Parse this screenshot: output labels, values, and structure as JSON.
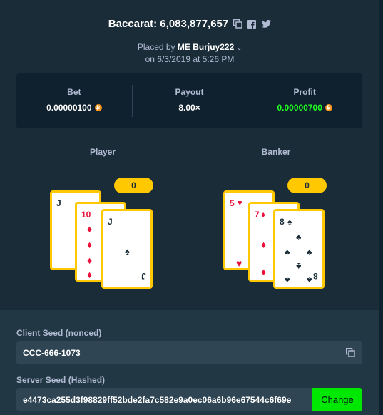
{
  "header": {
    "title": "Baccarat: 6,083,877,657",
    "placed_by_prefix": "Placed by",
    "placed_by_user": "ME Burjuy222",
    "placed_on": "on 6/3/2019 at 5:26 PM"
  },
  "stats": {
    "bet_label": "Bet",
    "bet_value": "0.00000100",
    "payout_label": "Payout",
    "payout_value": "8.00×",
    "profit_label": "Profit",
    "profit_value": "0.00000700",
    "currency_icon": "bitcoin-icon",
    "profit_color": "#1fff20"
  },
  "player": {
    "label": "Player",
    "score": "0",
    "cards": [
      {
        "rank": "J",
        "suit": "♠",
        "color": "black"
      },
      {
        "rank": "10",
        "suit": "♦",
        "color": "red"
      },
      {
        "rank": "J",
        "suit": "♠",
        "color": "black"
      }
    ]
  },
  "banker": {
    "label": "Banker",
    "score": "0",
    "cards": [
      {
        "rank": "5",
        "suit": "♥",
        "color": "red"
      },
      {
        "rank": "7",
        "suit": "♦",
        "color": "red"
      },
      {
        "rank": "8",
        "suit": "♠",
        "color": "black"
      }
    ]
  },
  "seeds": {
    "client_label": "Client Seed (nonced)",
    "client_value": "CCC-666-1073",
    "server_label": "Server Seed (Hashed)",
    "server_value": "e4473ca255d3f98829ff52bde2fa7c582e9a0ec06a6b96e67544c6f69e",
    "change_label": "Change"
  },
  "colors": {
    "accent": "#ffc800",
    "change_button": "#00e701"
  }
}
